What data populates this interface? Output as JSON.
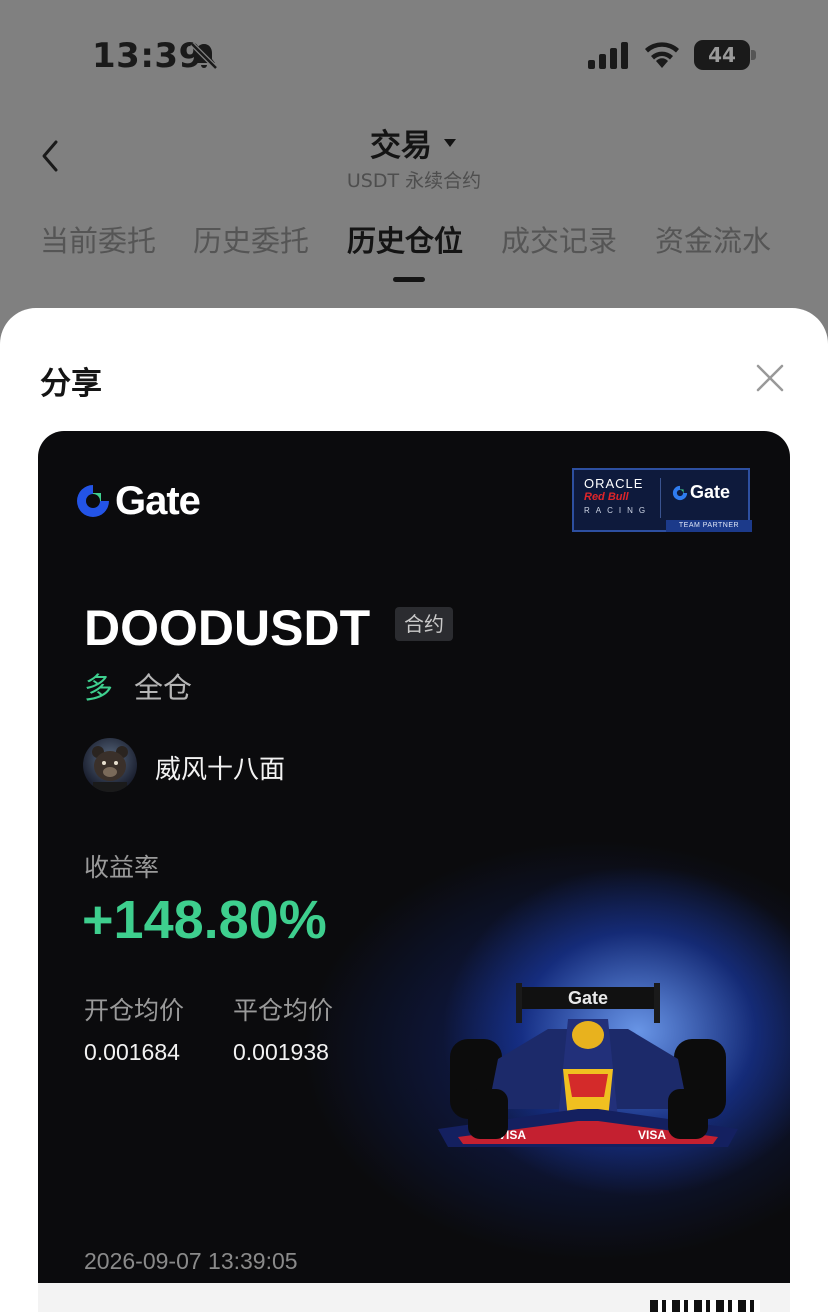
{
  "status_bar": {
    "time": "13:39",
    "battery": "44",
    "icons": [
      "bell-off-icon",
      "signal-icon",
      "wifi-icon",
      "battery-icon"
    ]
  },
  "header": {
    "title": "交易",
    "subtitle": "USDT 永续合约"
  },
  "tabs": [
    {
      "label": "当前委托",
      "active": false
    },
    {
      "label": "历史委托",
      "active": false
    },
    {
      "label": "历史仓位",
      "active": true
    },
    {
      "label": "成交记录",
      "active": false
    },
    {
      "label": "资金流水",
      "active": false
    }
  ],
  "share_sheet": {
    "title": "分享",
    "card": {
      "brand": "Gate",
      "partner": {
        "oracle": "ORACLE",
        "redbull": "Red Bull",
        "racing": "RACING",
        "gate": "Gate",
        "tag": "TEAM PARTNER"
      },
      "symbol": "DOODUSDT",
      "badge": "合约",
      "direction": "多",
      "margin_mode": "全仓",
      "username": "威风十八面",
      "roi_label": "收益率",
      "roi_value": "+148.80%",
      "open_price_label": "开仓均价",
      "close_price_label": "平仓均价",
      "open_price": "0.001684",
      "close_price": "0.001938",
      "timestamp": "2026-09-07 13:39:05",
      "car_livery_text": "Gate",
      "car_sponsor_text": "VISA"
    }
  },
  "colors": {
    "profit_green": "#3ecf8e",
    "card_bg": "#0b0b0d",
    "brand_blue": "#2354e6"
  }
}
